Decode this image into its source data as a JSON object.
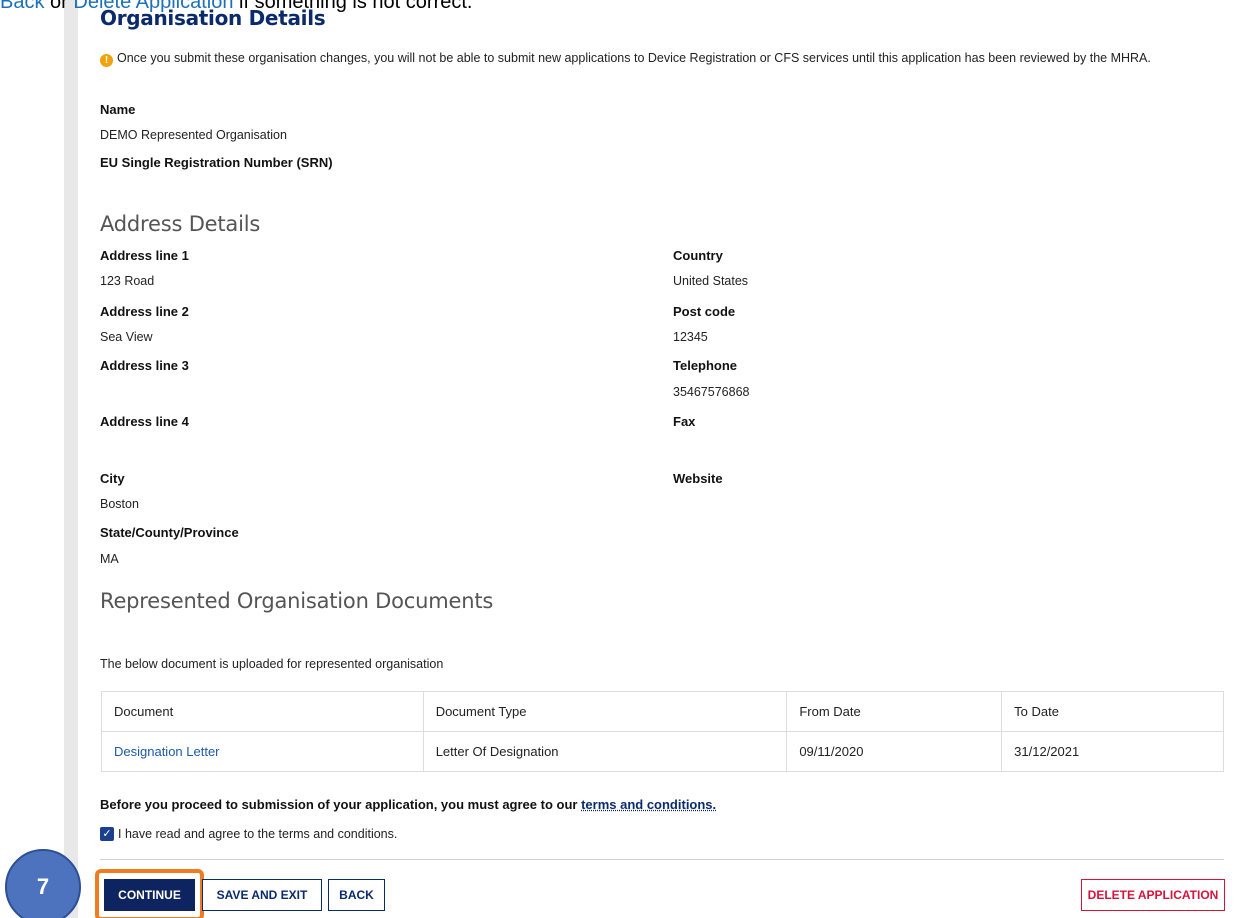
{
  "top_strip": {
    "link_back": "Back",
    "sep": " or ",
    "link_delete": "Delete Application",
    "tail": " if something is not correct."
  },
  "page_title": "Organisation Details",
  "warning_text": "Once you submit these organisation changes, you will not be able to submit new applications to Device Registration or CFS services until this application has been reviewed by the MHRA.",
  "org": {
    "name_label": "Name",
    "name_value": "DEMO Represented Organisation",
    "srn_label": "EU Single Registration Number (SRN)"
  },
  "address": {
    "heading": "Address Details",
    "line1_label": "Address line 1",
    "line1_value": "123 Road",
    "line2_label": "Address line 2",
    "line2_value": "Sea View",
    "line3_label": "Address line 3",
    "line4_label": "Address line 4",
    "city_label": "City",
    "city_value": "Boston",
    "state_label": "State/County/Province",
    "state_value": "MA",
    "country_label": "Country",
    "country_value": "United States",
    "postcode_label": "Post code",
    "postcode_value": "12345",
    "telephone_label": "Telephone",
    "telephone_value": "35467576868",
    "fax_label": "Fax",
    "website_label": "Website"
  },
  "documents": {
    "heading": "Represented Organisation Documents",
    "note": "The below  document is uploaded for represented organisation",
    "columns": [
      "Document",
      "Document Type",
      "From Date",
      "To Date"
    ],
    "rows": [
      [
        "Designation Letter",
        "Letter Of Designation",
        "09/11/2020",
        "31/12/2021"
      ]
    ]
  },
  "terms": {
    "prefix": "Before you proceed to submission of your application, you must agree to our ",
    "link": "terms and conditions.",
    "checkbox_label": "I have read and agree to the terms and conditions.",
    "checked": true
  },
  "buttons": {
    "continue": "CONTINUE",
    "save_exit": "SAVE AND EXIT",
    "back": "BACK",
    "delete": "DELETE APPLICATION"
  },
  "step_badge": "7",
  "colors": {
    "primary": "#0e2460",
    "link": "#1d5aa8",
    "danger": "#d4143b",
    "highlight": "#f07c1f",
    "badge": "#4d73be"
  }
}
